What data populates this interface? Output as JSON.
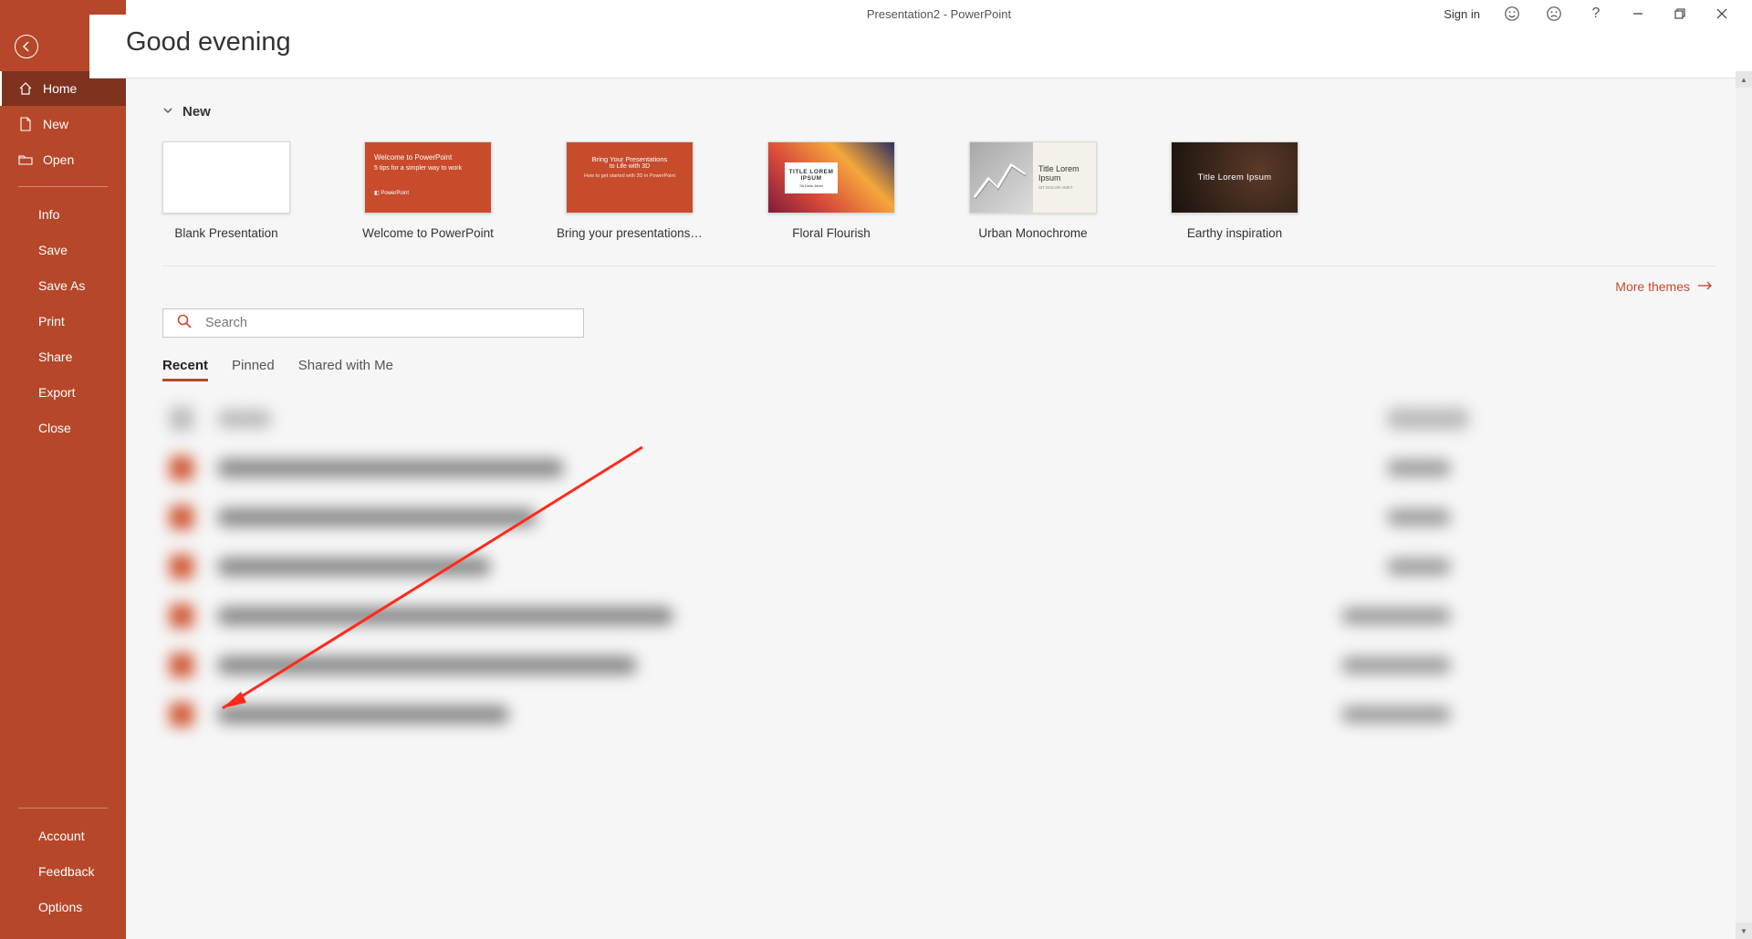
{
  "titlebar": {
    "title": "Presentation2  -  PowerPoint",
    "signin": "Sign in"
  },
  "sidebar": {
    "home": "Home",
    "new": "New",
    "open": "Open",
    "info": "Info",
    "save": "Save",
    "saveas": "Save As",
    "print": "Print",
    "share": "Share",
    "export": "Export",
    "close": "Close",
    "account": "Account",
    "feedback": "Feedback",
    "options": "Options"
  },
  "greeting": "Good evening",
  "section_new": "New",
  "templates": [
    {
      "label": "Blank Presentation"
    },
    {
      "label": "Welcome to PowerPoint"
    },
    {
      "label": "Bring your presentations to..."
    },
    {
      "label": "Floral Flourish"
    },
    {
      "label": "Urban Monochrome"
    },
    {
      "label": "Earthy inspiration"
    }
  ],
  "thumb": {
    "welcome_title": "Welcome to PowerPoint",
    "welcome_sub": "5 tips for a simpler way to work",
    "welcome_foot": "PowerPoint",
    "bring_title": "Bring Your Presentations",
    "bring_sub": "to Life with 3D",
    "bring_hint": "How to get started with 3D in PowerPoint",
    "floral_title": "TITLE LOREM",
    "floral_sub": "IPSUM",
    "floral_small": "Sit Dolor Amet",
    "mono_title1": "Title Lorem",
    "mono_title2": "Ipsum",
    "mono_sub": "SIT DOLOR AMET",
    "earthy_title": "Title Lorem Ipsum"
  },
  "more_themes": "More themes",
  "search_placeholder": "Search",
  "tabs": {
    "recent": "Recent",
    "pinned": "Pinned",
    "shared": "Shared with Me"
  },
  "colors": {
    "accent": "#b7472a",
    "accent_dark": "#7f321e",
    "link": "#c84b2b"
  }
}
